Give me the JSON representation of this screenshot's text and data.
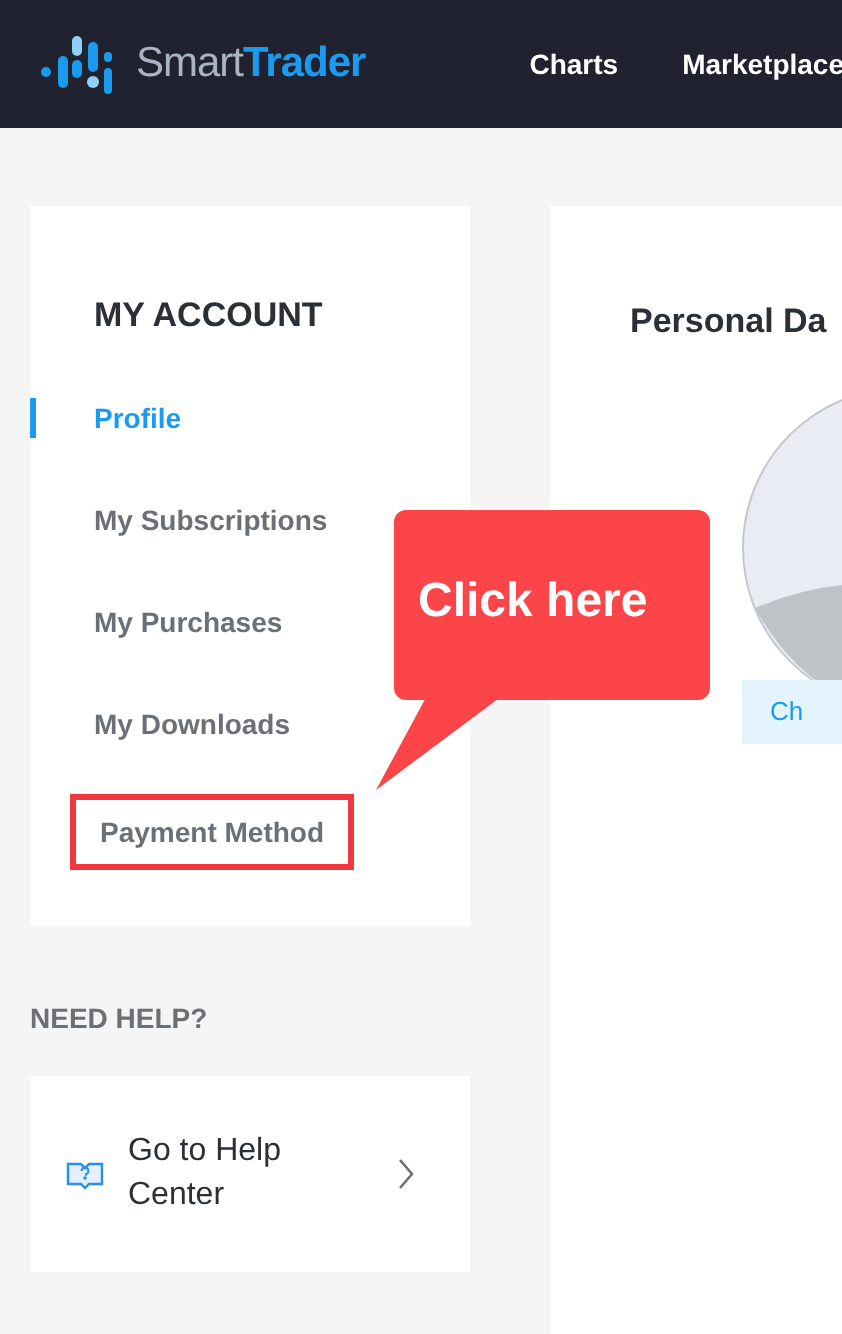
{
  "navbar": {
    "logo": {
      "light": "Smart",
      "bold": "Trader"
    },
    "links": [
      {
        "label": "Charts"
      },
      {
        "label": "Marketplace"
      }
    ]
  },
  "account": {
    "title": "MY ACCOUNT",
    "items": [
      {
        "label": "Profile",
        "selected": true,
        "highlighted": false
      },
      {
        "label": "My Subscriptions",
        "selected": false,
        "highlighted": false
      },
      {
        "label": "My Purchases",
        "selected": false,
        "highlighted": false
      },
      {
        "label": "My Downloads",
        "selected": false,
        "highlighted": false
      },
      {
        "label": "Payment Method",
        "selected": false,
        "highlighted": true
      }
    ]
  },
  "help": {
    "heading": "NEED HELP?",
    "link": "Go to Help Center"
  },
  "main": {
    "title": "Personal Da",
    "button": "Ch"
  },
  "callout": {
    "text": "Click here"
  }
}
